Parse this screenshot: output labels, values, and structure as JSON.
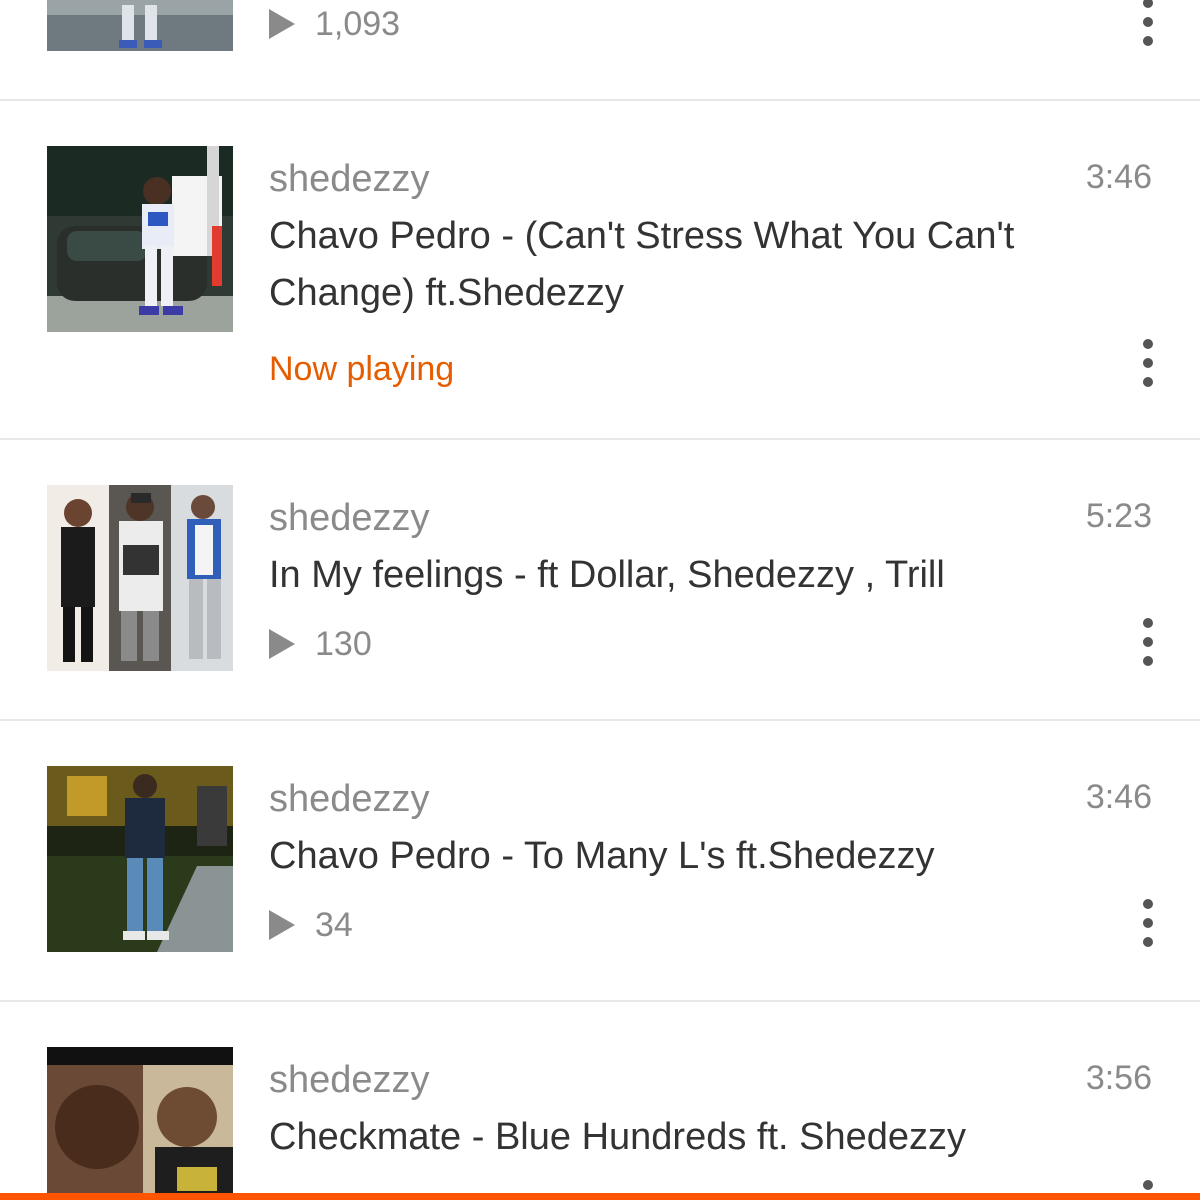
{
  "colors": {
    "accent": "#ff5500",
    "now_playing": "#e65c00",
    "secondary_text": "#8a8a8a",
    "primary_text": "#333333"
  },
  "tracks": [
    {
      "user": "",
      "title": "",
      "duration": "",
      "plays": "1,093",
      "status": ""
    },
    {
      "user": "shedezzy",
      "title": "Chavo Pedro - (Can't Stress What You Can't Change) ft.Shedezzy",
      "duration": "3:46",
      "plays": "",
      "status": "Now playing"
    },
    {
      "user": "shedezzy",
      "title": "In My feelings - ft Dollar,  Shedezzy , Trill",
      "duration": "5:23",
      "plays": "130",
      "status": ""
    },
    {
      "user": "shedezzy",
      "title": "Chavo Pedro - To Many L's ft.Shedezzy",
      "duration": "3:46",
      "plays": "34",
      "status": ""
    },
    {
      "user": "shedezzy",
      "title": "Checkmate - Blue Hundreds ft. Shedezzy",
      "duration": "3:56",
      "plays": "",
      "status": ""
    }
  ],
  "icons": {
    "play": "play-icon",
    "overflow": "more-vert-icon"
  }
}
